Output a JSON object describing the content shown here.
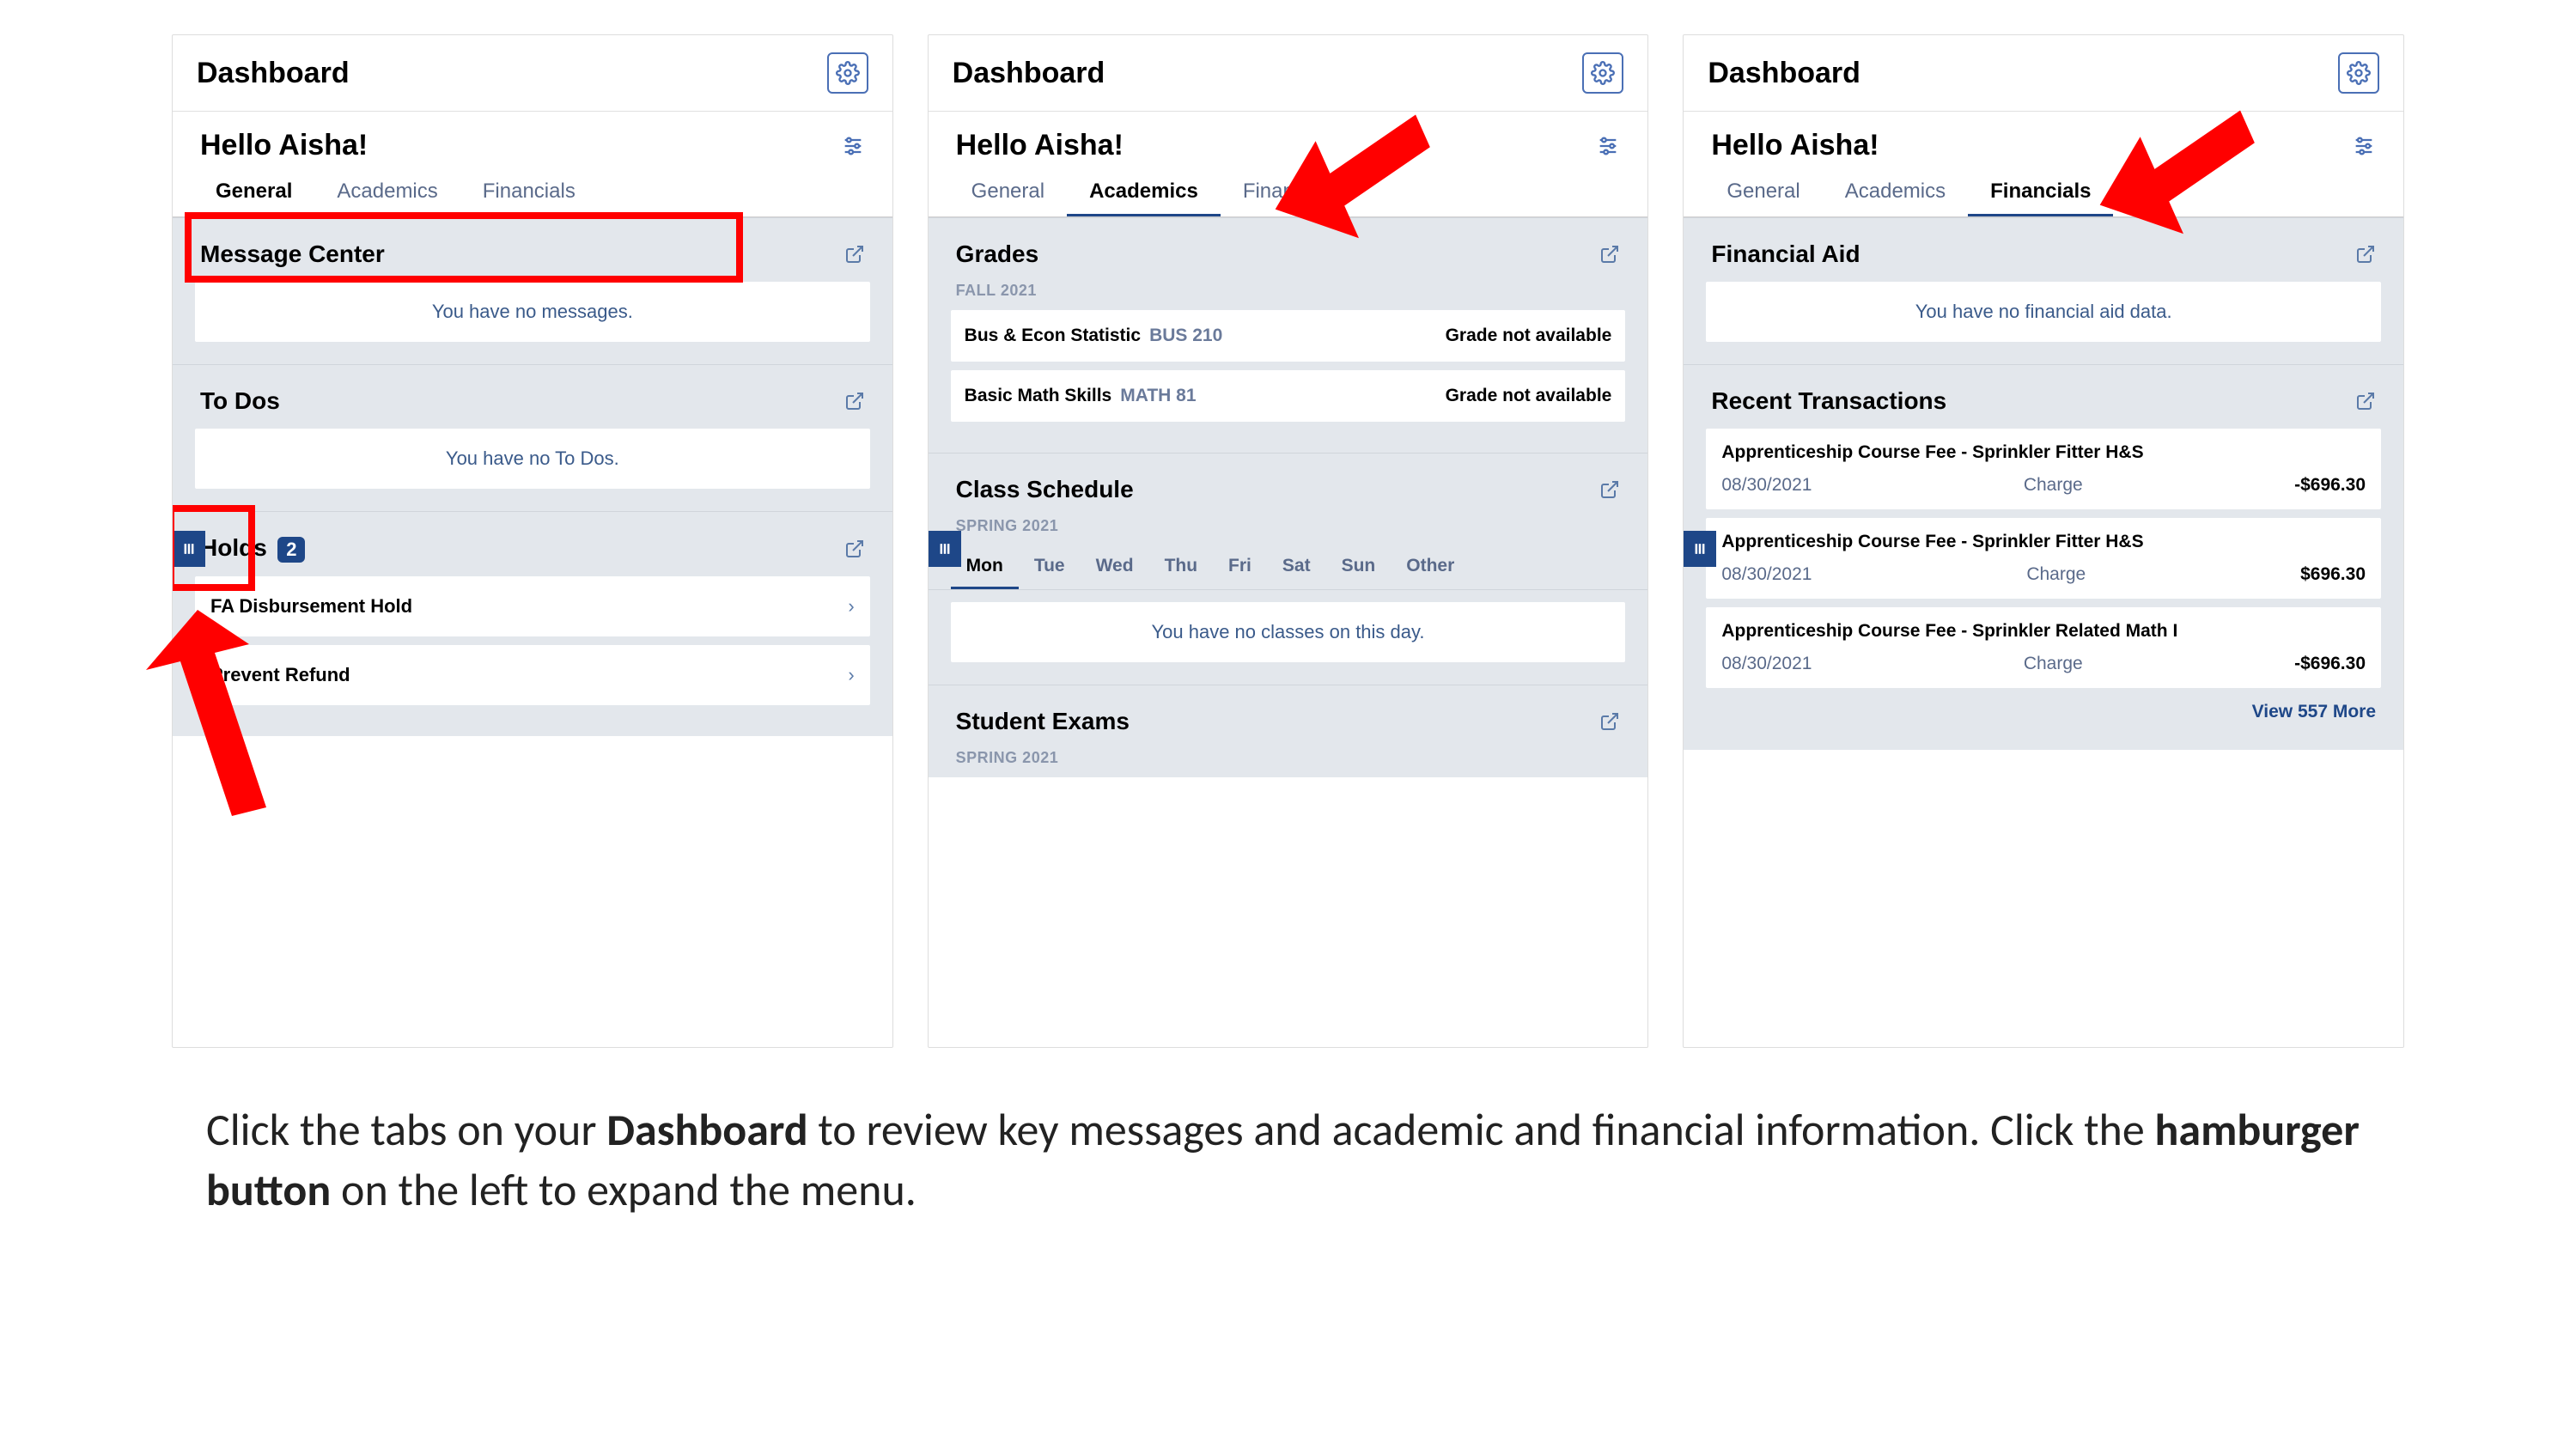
{
  "header_title": "Dashboard",
  "greeting": "Hello Aisha!",
  "tabs": {
    "general": "General",
    "academics": "Academics",
    "financials": "Financials"
  },
  "panel1": {
    "message_center": {
      "title": "Message Center",
      "empty": "You have no messages."
    },
    "todos": {
      "title": "To Dos",
      "empty": "You have no To Dos."
    },
    "holds": {
      "title": "Holds",
      "count": "2",
      "items": [
        "FA Disbursement Hold",
        "Prevent Refund"
      ]
    }
  },
  "panel2": {
    "grades": {
      "title": "Grades",
      "term": "FALL 2021",
      "rows": [
        {
          "name": "Bus & Econ Statistic",
          "code": "BUS 210",
          "status": "Grade not available"
        },
        {
          "name": "Basic Math Skills",
          "code": "MATH 81",
          "status": "Grade not available"
        }
      ]
    },
    "schedule": {
      "title": "Class Schedule",
      "term": "SPRING 2021",
      "days": [
        "Mon",
        "Tue",
        "Wed",
        "Thu",
        "Fri",
        "Sat",
        "Sun",
        "Other"
      ],
      "empty": "You have no classes on this day."
    },
    "exams": {
      "title": "Student Exams",
      "term": "SPRING 2021"
    }
  },
  "panel3": {
    "financial_aid": {
      "title": "Financial Aid",
      "empty": "You have no financial aid data."
    },
    "transactions": {
      "title": "Recent Transactions",
      "rows": [
        {
          "title": "Apprenticeship Course Fee - Sprinkler Fitter H&S",
          "date": "08/30/2021",
          "type": "Charge",
          "amount": "-$696.30"
        },
        {
          "title": "Apprenticeship Course Fee - Sprinkler Fitter H&S",
          "date": "08/30/2021",
          "type": "Charge",
          "amount": "$696.30"
        },
        {
          "title": "Apprenticeship Course Fee - Sprinkler Related Math I",
          "date": "08/30/2021",
          "type": "Charge",
          "amount": "-$696.30"
        }
      ],
      "view_more": "View 557 More"
    }
  },
  "caption": {
    "p1a": "Click the tabs on your ",
    "p1b": "Dashboard",
    "p1c": " to review key messages and  academic and financial information. Click the ",
    "p1d": "hamburger button",
    "p1e": " on the left to expand the menu."
  }
}
